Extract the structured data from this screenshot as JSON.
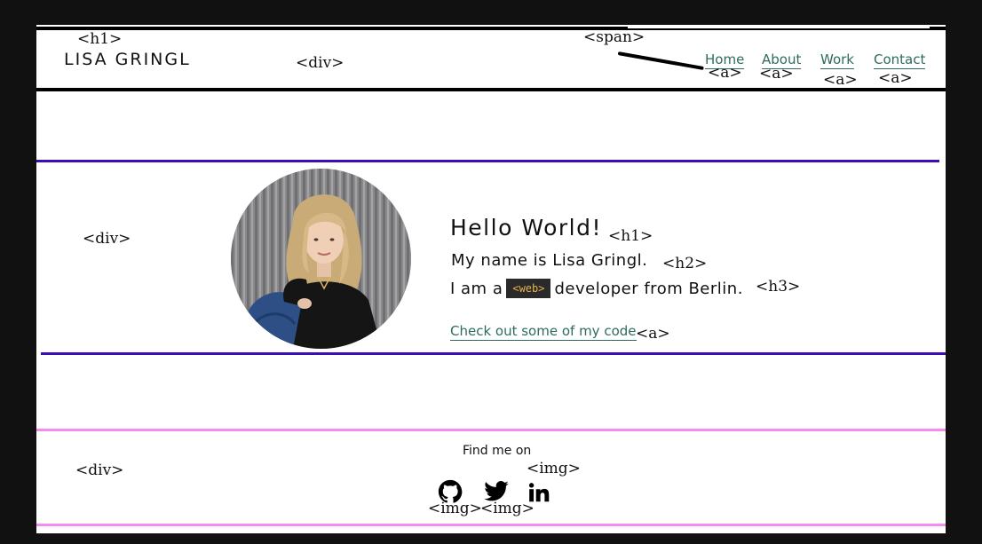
{
  "header": {
    "title": "LISA GRINGL",
    "nav": [
      {
        "label": "Home"
      },
      {
        "label": "About"
      },
      {
        "label": "Work"
      },
      {
        "label": "Contact"
      }
    ]
  },
  "hero": {
    "greeting": "Hello World!",
    "name_line": "My name is Lisa Gringl.",
    "role_prefix": "I am a",
    "role_code": "<web>",
    "role_suffix": "developer from Berlin.",
    "code_link": "Check out some of my code"
  },
  "footer": {
    "find_me": "Find me on"
  },
  "tag_labels": {
    "h1": "<h1>",
    "div": "<div>",
    "span": "<span>",
    "a": "<a>",
    "h2": "<h2>",
    "h3": "<h3>",
    "img": "<img>"
  },
  "colors": {
    "background": "#111111",
    "page": "#ffffff",
    "link": "#2e6b5e",
    "code_chip_bg": "#2a2a2a",
    "code_chip_text": "#e6b14f",
    "hero_rule": "#3a0fb5",
    "footer_rule": "#f58af0"
  },
  "icons": [
    "github-icon",
    "twitter-icon",
    "linkedin-icon"
  ]
}
